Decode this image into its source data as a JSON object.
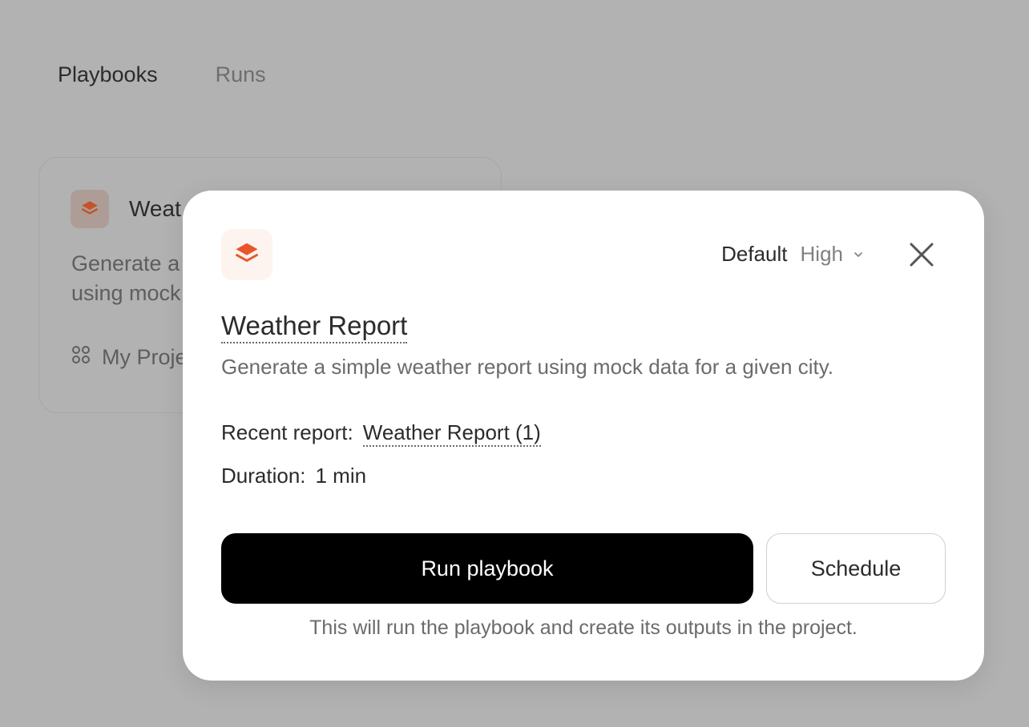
{
  "colors": {
    "accent": "#e8562a",
    "overlay": "#b2b2b2",
    "primary_button": "#000000"
  },
  "tabs": [
    {
      "label": "Playbooks",
      "active": true
    },
    {
      "label": "Runs",
      "active": false
    }
  ],
  "card": {
    "icon": "layers-icon",
    "title": "Weat",
    "description_lines": [
      "Generate a",
      "using mock"
    ],
    "project_icon": "grid-icon",
    "project_label": "My Proje"
  },
  "modal": {
    "icon": "layers-icon",
    "mode_label": "Default",
    "level_value": "High",
    "title": "Weather Report",
    "description": "Generate a simple weather report using mock data for a given city.",
    "recent_report_label": "Recent report:",
    "recent_report_value": "Weather Report (1)",
    "duration_label": "Duration:",
    "duration_value": "1 min",
    "run_button_label": "Run playbook",
    "schedule_button_label": "Schedule",
    "footnote": "This will run the playbook and create its outputs in the project."
  }
}
